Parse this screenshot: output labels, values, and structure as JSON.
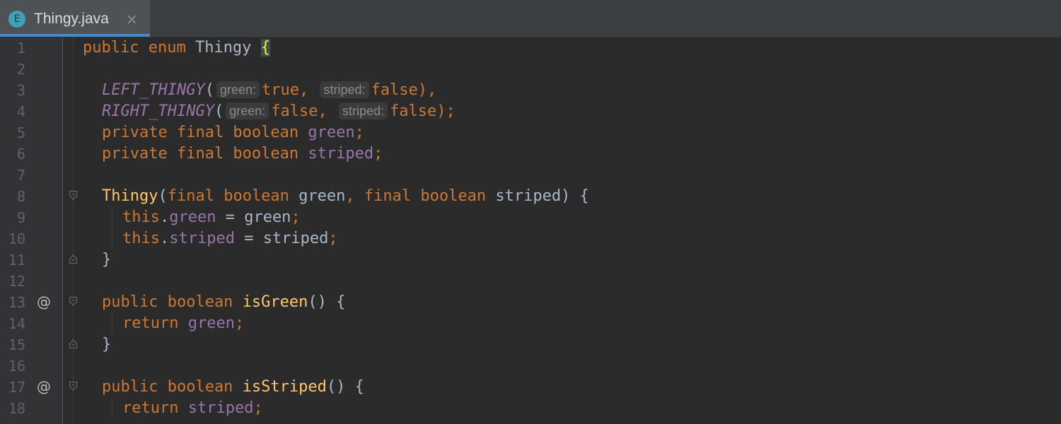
{
  "tab": {
    "icon_letter": "E",
    "filename": "Thingy.java",
    "close_glyph": "×"
  },
  "lines": [
    {
      "no": "1"
    },
    {
      "no": "2"
    },
    {
      "no": "3"
    },
    {
      "no": "4"
    },
    {
      "no": "5"
    },
    {
      "no": "6"
    },
    {
      "no": "7"
    },
    {
      "no": "8"
    },
    {
      "no": "9"
    },
    {
      "no": "10"
    },
    {
      "no": "11"
    },
    {
      "no": "12"
    },
    {
      "no": "13",
      "marker": "@"
    },
    {
      "no": "14"
    },
    {
      "no": "15"
    },
    {
      "no": "16"
    },
    {
      "no": "17",
      "marker": "@"
    },
    {
      "no": "18"
    }
  ],
  "code": {
    "l1": {
      "kw": "public enum",
      "name": "Thingy",
      "brace": "{"
    },
    "l3": {
      "const": "LEFT_THINGY",
      "open": "(",
      "hint1": "green:",
      "v1": "true,",
      "hint2": "striped:",
      "v2": "false",
      "close": "),"
    },
    "l4": {
      "const": "RIGHT_THINGY",
      "open": "(",
      "hint1": "green:",
      "v1": "false,",
      "hint2": "striped:",
      "v2": "false",
      "close": ");"
    },
    "l5": {
      "kw": "private final boolean",
      "field": "green",
      "semi": ";"
    },
    "l6": {
      "kw": "private final boolean",
      "field": "striped",
      "semi": ";"
    },
    "l8": {
      "name": "Thingy",
      "open": "(",
      "kw1": "final boolean",
      "p1": "green",
      "comma": ",",
      "kw2": "final boolean",
      "p2": "striped",
      "close": ") {"
    },
    "l9": {
      "kw": "this",
      "dot": ".",
      "field": "green",
      "eq": " = green",
      "semi": ";"
    },
    "l10": {
      "kw": "this",
      "dot": ".",
      "field": "striped",
      "eq": " = striped",
      "semi": ";"
    },
    "l11": {
      "brace": "}"
    },
    "l13": {
      "kw": "public boolean",
      "name": "isGreen",
      "rest": "() {"
    },
    "l14": {
      "kw": "return",
      "field": "green",
      "semi": ";"
    },
    "l15": {
      "brace": "}"
    },
    "l17": {
      "kw": "public boolean",
      "name": "isStriped",
      "rest": "() {"
    },
    "l18": {
      "kw": "return",
      "field": "striped",
      "semi": ";"
    }
  },
  "colors": {
    "background": "#2b2b2b",
    "keyword": "#cc7832",
    "field": "#9876aa",
    "method": "#ffc66d",
    "plain": "#a9b7c6",
    "tab_accent": "#4a88c7"
  }
}
